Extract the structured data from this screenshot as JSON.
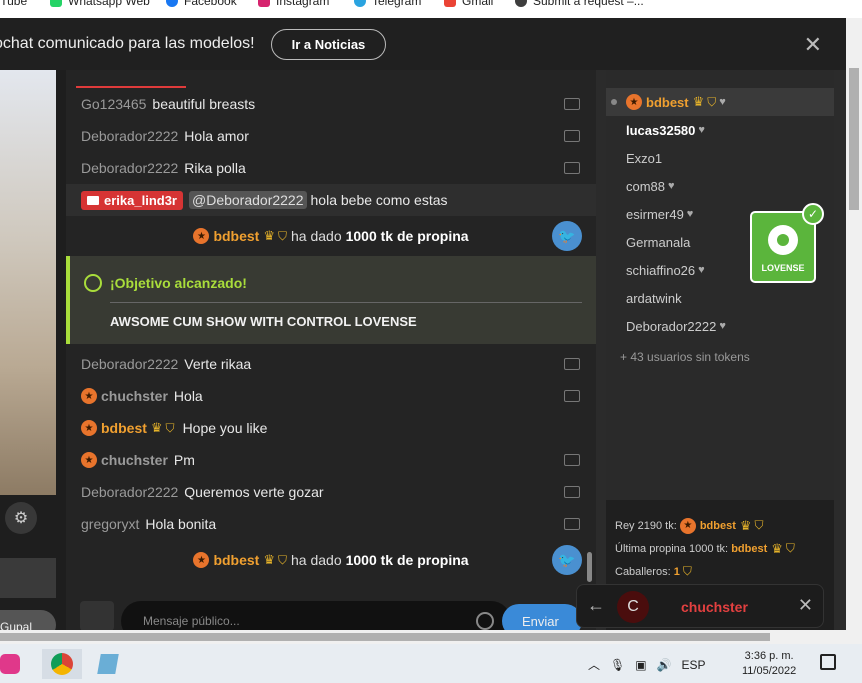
{
  "bookmarks": [
    {
      "label": "YouTube",
      "icon": "youtube-icon"
    },
    {
      "label": "Whatsapp Web",
      "icon": "whatsapp-icon"
    },
    {
      "label": "Facebook",
      "icon": "facebook-icon"
    },
    {
      "label": "Instagram",
      "icon": "instagram-icon"
    },
    {
      "label": "Telegram",
      "icon": "telegram-icon"
    },
    {
      "label": "Gmail",
      "icon": "gmail-icon"
    },
    {
      "label": "Submit a request –...",
      "icon": "zendesk-icon"
    }
  ],
  "banner": {
    "text": "ochat comunicado para las modelos!",
    "button": "Ir a Noticias",
    "close": "✕"
  },
  "chat": {
    "messages": [
      {
        "user": "Go123465",
        "text": "beautiful breasts"
      },
      {
        "user": "Deborador2222",
        "text": "Hola amor"
      },
      {
        "user": "Deborador2222",
        "text": "Rika polla"
      },
      {
        "user": "erika_lind3r",
        "mention": "@Deborador2222",
        "text": "hola bebe como estas"
      },
      {
        "user": "bdbest",
        "tip_text": "ha dado",
        "amount": "1000 tk de propina"
      },
      {
        "goal_title": "¡Objetivo alcanzado!",
        "goal_text": "AWSOME CUM SHOW WITH CONTROL LOVENSE"
      },
      {
        "user": "Deborador2222",
        "text": "Verte rikaa"
      },
      {
        "user": "chuchster",
        "text": "Hola"
      },
      {
        "user": "bdbest",
        "text": "Hope you like"
      },
      {
        "user": "chuchster",
        "text": "Pm"
      },
      {
        "user": "Deborador2222",
        "text": "Queremos verte gozar"
      },
      {
        "user": "gregoryxt",
        "text": "Hola bonita"
      },
      {
        "user": "bdbest",
        "tip_text": "ha dado",
        "amount": "1000 tk de propina"
      }
    ],
    "input_placeholder": "Mensaje público...",
    "send": "Enviar",
    "left_button": "Gupal"
  },
  "users": {
    "list": [
      "bdbest",
      "lucas32580",
      "Exzo1",
      "com88",
      "esirmer49",
      "Germanala",
      "schiaffino26",
      "ardatwink",
      "Deborador2222"
    ],
    "more": "+ 43 usuarios sin tokens"
  },
  "lovense": {
    "label": "LOVENSE"
  },
  "stats": {
    "king_label": "Rey 2190 tk:",
    "king_user": "bdbest",
    "last_tip_label": "Última propina 1000 tk:",
    "last_tip_user": "bdbest",
    "knights_label": "Caballeros:",
    "knights_value": "1"
  },
  "pm": {
    "avatar": "C",
    "user": "chuchster"
  },
  "taskbar": {
    "lang": "ESP",
    "time": "3:36 p. m.",
    "date": "11/05/2022"
  },
  "colors": {
    "accent": "#e03b3b",
    "goal": "#a9dd3b",
    "tip": "#f0a030",
    "send": "#3a8ad8",
    "lovense": "#5bb53c"
  }
}
